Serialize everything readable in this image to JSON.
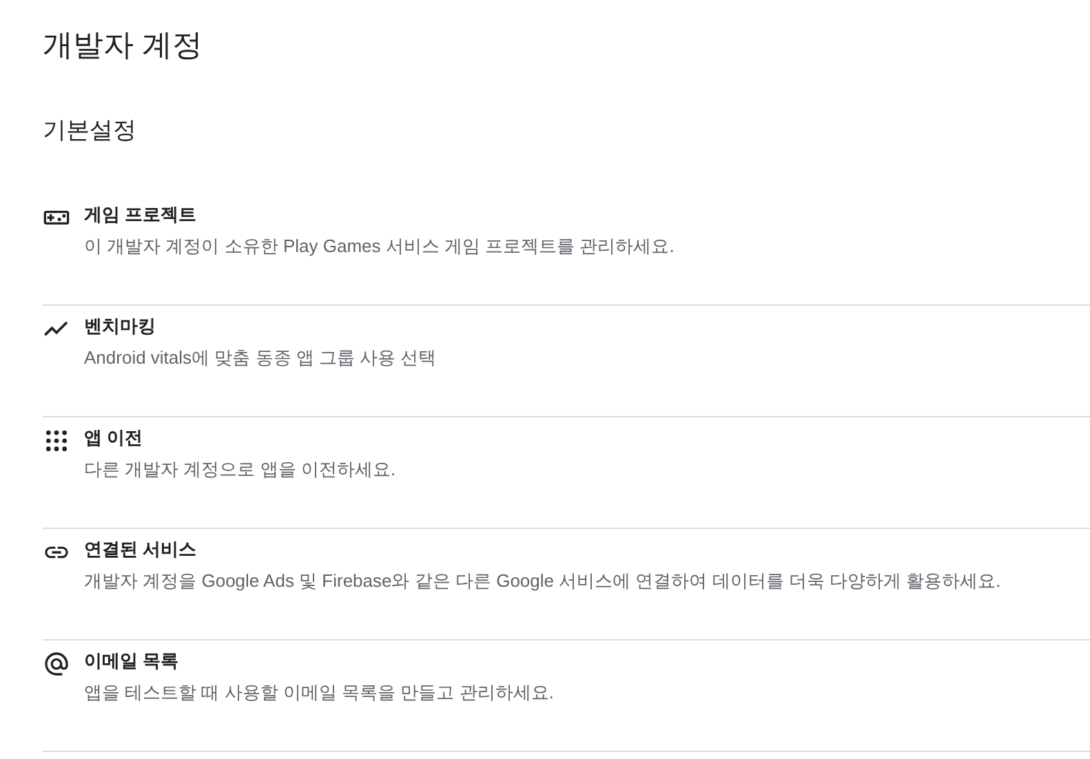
{
  "page_title": "개발자 계정",
  "section_title": "기본설정",
  "items": [
    {
      "title": "게임 프로젝트",
      "description": "이 개발자 계정이 소유한 Play Games 서비스 게임 프로젝트를 관리하세요."
    },
    {
      "title": "벤치마킹",
      "description": "Android vitals에 맞춤 동종 앱 그룹 사용 선택"
    },
    {
      "title": "앱 이전",
      "description": "다른 개발자 계정으로 앱을 이전하세요."
    },
    {
      "title": "연결된 서비스",
      "description": "개발자 계정을 Google Ads 및 Firebase와 같은 다른 Google 서비스에 연결하여 데이터를 더욱 다양하게 활용하세요."
    },
    {
      "title": "이메일 목록",
      "description": "앱을 테스트할 때 사용할 이메일 목록을 만들고 관리하세요."
    }
  ]
}
